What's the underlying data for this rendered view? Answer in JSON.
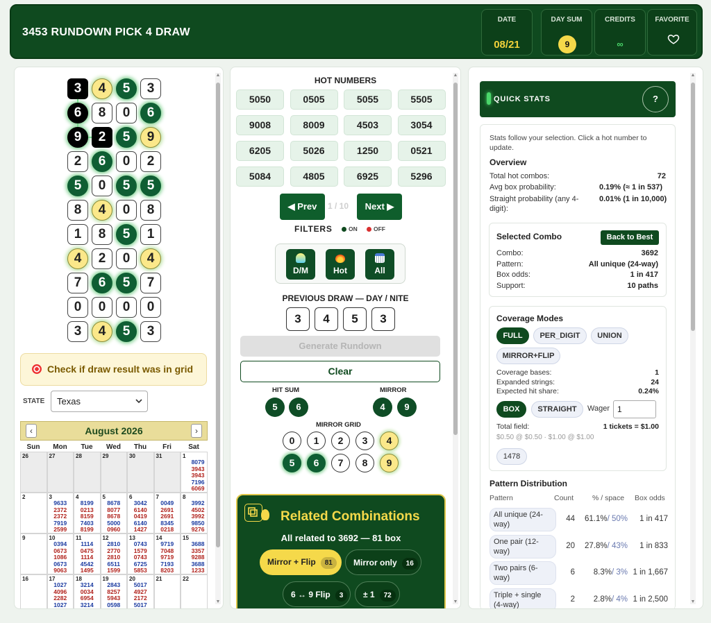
{
  "header": {
    "title": "3453 RUNDOWN PICK 4 DRAW",
    "date_label": "DATE",
    "date_value": "08/21",
    "daysum_label": "DAY SUM",
    "daysum_value": "9",
    "credits_label": "CREDITS",
    "credits_value": "∞",
    "favorite_label": "FAVORITE"
  },
  "grid": {
    "rows": [
      [
        {
          "v": "3",
          "s": "k"
        },
        {
          "v": "4",
          "s": "y"
        },
        {
          "v": "5",
          "s": "g"
        },
        {
          "v": "3",
          "s": "n"
        }
      ],
      [
        {
          "v": "6",
          "s": "kc"
        },
        {
          "v": "8",
          "s": "n"
        },
        {
          "v": "0",
          "s": "n"
        },
        {
          "v": "6",
          "s": "g"
        }
      ],
      [
        {
          "v": "9",
          "s": "kc"
        },
        {
          "v": "2",
          "s": "k"
        },
        {
          "v": "5",
          "s": "g"
        },
        {
          "v": "9",
          "s": "y"
        }
      ],
      [
        {
          "v": "2",
          "s": "n"
        },
        {
          "v": "6",
          "s": "g"
        },
        {
          "v": "0",
          "s": "n"
        },
        {
          "v": "2",
          "s": "n"
        }
      ],
      [
        {
          "v": "5",
          "s": "g"
        },
        {
          "v": "0",
          "s": "n"
        },
        {
          "v": "5",
          "s": "g"
        },
        {
          "v": "5",
          "s": "g"
        }
      ],
      [
        {
          "v": "8",
          "s": "n"
        },
        {
          "v": "4",
          "s": "y"
        },
        {
          "v": "0",
          "s": "n"
        },
        {
          "v": "8",
          "s": "n"
        }
      ],
      [
        {
          "v": "1",
          "s": "n"
        },
        {
          "v": "8",
          "s": "n"
        },
        {
          "v": "5",
          "s": "g"
        },
        {
          "v": "1",
          "s": "n"
        }
      ],
      [
        {
          "v": "4",
          "s": "y"
        },
        {
          "v": "2",
          "s": "n"
        },
        {
          "v": "0",
          "s": "n"
        },
        {
          "v": "4",
          "s": "y"
        }
      ],
      [
        {
          "v": "7",
          "s": "n"
        },
        {
          "v": "6",
          "s": "g"
        },
        {
          "v": "5",
          "s": "g"
        },
        {
          "v": "7",
          "s": "n"
        }
      ],
      [
        {
          "v": "0",
          "s": "n"
        },
        {
          "v": "0",
          "s": "n"
        },
        {
          "v": "0",
          "s": "n"
        },
        {
          "v": "0",
          "s": "n"
        }
      ],
      [
        {
          "v": "3",
          "s": "n"
        },
        {
          "v": "4",
          "s": "y"
        },
        {
          "v": "5",
          "s": "g"
        },
        {
          "v": "3",
          "s": "n"
        }
      ]
    ]
  },
  "check_label": "Check if draw result was in grid",
  "state": {
    "label": "STATE",
    "value": "Texas"
  },
  "calendar": {
    "month": "August 2026",
    "dow": [
      "Sun",
      "Mon",
      "Tue",
      "Wed",
      "Thu",
      "Fri",
      "Sat"
    ],
    "weeks": [
      [
        {
          "d": "26",
          "g": true,
          "n": []
        },
        {
          "d": "27",
          "g": true,
          "n": []
        },
        {
          "d": "28",
          "g": true,
          "n": []
        },
        {
          "d": "29",
          "g": true,
          "n": []
        },
        {
          "d": "30",
          "g": true,
          "n": []
        },
        {
          "d": "31",
          "g": true,
          "n": []
        },
        {
          "d": "1",
          "g": false,
          "n": [
            "8079",
            "3943",
            "3943",
            "7196",
            "6069"
          ]
        }
      ],
      [
        {
          "d": "2",
          "g": false,
          "n": []
        },
        {
          "d": "3",
          "g": false,
          "n": [
            "9633",
            "2372",
            "2372",
            "7919",
            "2599"
          ]
        },
        {
          "d": "4",
          "g": false,
          "n": [
            "8199",
            "0213",
            "8159",
            "7403",
            "8199"
          ]
        },
        {
          "d": "5",
          "g": false,
          "n": [
            "8678",
            "8077",
            "8678",
            "5000",
            "0960"
          ]
        },
        {
          "d": "6",
          "g": false,
          "n": [
            "3042",
            "6140",
            "0419",
            "6140",
            "1427"
          ]
        },
        {
          "d": "7",
          "g": false,
          "n": [
            "0049",
            "2691",
            "2691",
            "8345",
            "0218"
          ]
        },
        {
          "d": "8",
          "g": false,
          "n": [
            "3992",
            "4502",
            "3992",
            "9850",
            "9276"
          ]
        }
      ],
      [
        {
          "d": "9",
          "g": false,
          "n": []
        },
        {
          "d": "10",
          "g": false,
          "n": [
            "0394",
            "0673",
            "1086",
            "0673",
            "9063"
          ]
        },
        {
          "d": "11",
          "g": false,
          "n": [
            "1114",
            "0475",
            "1114",
            "4542",
            "1495"
          ]
        },
        {
          "d": "12",
          "g": false,
          "n": [
            "2810",
            "2770",
            "2810",
            "6511",
            "1599"
          ]
        },
        {
          "d": "13",
          "g": false,
          "n": [
            "0743",
            "1579",
            "0743",
            "6725",
            "5853"
          ]
        },
        {
          "d": "14",
          "g": false,
          "n": [
            "9719",
            "7048",
            "9719",
            "7193",
            "8203"
          ]
        },
        {
          "d": "15",
          "g": false,
          "n": [
            "3688",
            "3357",
            "9288",
            "3688",
            "1233"
          ]
        }
      ],
      [
        {
          "d": "16",
          "g": false,
          "n": []
        },
        {
          "d": "17",
          "g": false,
          "n": [
            "1027",
            "4096",
            "2282",
            "1027"
          ]
        },
        {
          "d": "18",
          "g": false,
          "n": [
            "3214",
            "0034",
            "6954",
            "3214"
          ]
        },
        {
          "d": "19",
          "g": false,
          "n": [
            "2843",
            "8257",
            "5943",
            "0598"
          ]
        },
        {
          "d": "20",
          "g": false,
          "n": [
            "5017",
            "4927",
            "2172",
            "5017"
          ]
        },
        {
          "d": "21",
          "g": false,
          "n": []
        },
        {
          "d": "22",
          "g": false,
          "n": []
        }
      ]
    ]
  },
  "hot": {
    "title": "HOT NUMBERS",
    "numbers": [
      "5050",
      "0505",
      "5055",
      "5505",
      "9008",
      "8009",
      "4503",
      "3054",
      "6205",
      "5026",
      "1250",
      "0521",
      "5084",
      "4805",
      "6925",
      "5296"
    ],
    "prev": "◀ Prev",
    "next": "Next ▶",
    "page": "1 / 10"
  },
  "filters": {
    "label": "FILTERS",
    "on": "ON",
    "off": "OFF",
    "buttons": [
      "D/M",
      "Hot",
      "All"
    ]
  },
  "prev_draw": {
    "label": "PREVIOUS DRAW — DAY / NITE",
    "digits": [
      "3",
      "4",
      "5",
      "3"
    ]
  },
  "generate_label": "Generate Rundown",
  "clear_label": "Clear",
  "hit_sum": {
    "label": "HIT SUM",
    "values": [
      "5",
      "6"
    ]
  },
  "mirror": {
    "label": "MIRROR",
    "values": [
      "4",
      "9"
    ]
  },
  "mirror_grid": {
    "label": "MIRROR GRID",
    "cells": [
      {
        "v": "0",
        "s": "n"
      },
      {
        "v": "1",
        "s": "n"
      },
      {
        "v": "2",
        "s": "n"
      },
      {
        "v": "3",
        "s": "n"
      },
      {
        "v": "4",
        "s": "y"
      },
      {
        "v": "5",
        "s": "g"
      },
      {
        "v": "6",
        "s": "g"
      },
      {
        "v": "7",
        "s": "n"
      },
      {
        "v": "8",
        "s": "n"
      },
      {
        "v": "9",
        "s": "y"
      }
    ]
  },
  "related": {
    "title": "Related Combinations",
    "subtitle": "All related to 3692 — 81 box",
    "pills": [
      {
        "label": "Mirror + Flip",
        "count": "81"
      },
      {
        "label": "Mirror only",
        "count": "16"
      },
      {
        "label": "6 ↔ 9 Flip",
        "count": "3"
      },
      {
        "label": "± 1",
        "count": "72"
      }
    ]
  },
  "stats": {
    "title": "QUICK STATS",
    "help": "?",
    "intro": "Stats follow your selection. Click a hot number to update.",
    "overview_title": "Overview",
    "overview": [
      {
        "k": "Total hot combos:",
        "v": "72"
      },
      {
        "k": "Avg box probability:",
        "v": "0.19% (≈ 1 in 537)"
      },
      {
        "k": "Straight probability (any 4-digit):",
        "v": "0.01% (1 in 10,000)"
      }
    ],
    "selected": {
      "title": "Selected Combo",
      "back_label": "Back to Best",
      "rows": [
        {
          "k": "Combo:",
          "v": "3692"
        },
        {
          "k": "Pattern:",
          "v": "All unique (24-way)"
        },
        {
          "k": "Box odds:",
          "v": "1 in 417"
        },
        {
          "k": "Support:",
          "v": "10 paths"
        }
      ]
    },
    "coverage": {
      "title": "Coverage Modes",
      "modes": [
        "FULL",
        "PER_DIGIT",
        "UNION",
        "MIRROR+FLIP"
      ],
      "rows": [
        {
          "k": "Coverage bases:",
          "v": "1"
        },
        {
          "k": "Expanded strings:",
          "v": "24"
        },
        {
          "k": "Expected hit share:",
          "v": "0.24%"
        }
      ],
      "box_label": "BOX",
      "straight_label": "STRAIGHT",
      "wager_label": "Wager",
      "wager_value": "1",
      "total_label": "Total field:",
      "total_value": "1 tickets = $1.00",
      "price_note": "$0.50 @ $0.50 · $1.00 @ $1.00",
      "tag": "1478"
    },
    "pattern": {
      "title": "Pattern Distribution",
      "headers": [
        "Pattern",
        "Count",
        "% / space",
        "Box odds"
      ],
      "rows": [
        {
          "p": "All unique (24-way)",
          "c": "44",
          "pct": "61.1%",
          "sp": "/ 50%",
          "o": "1 in 417"
        },
        {
          "p": "One pair (12-way)",
          "c": "20",
          "pct": "27.8%",
          "sp": "/ 43%",
          "o": "1 in 833"
        },
        {
          "p": "Two pairs (6-way)",
          "c": "6",
          "pct": "8.3%",
          "sp": "/ 3%",
          "o": "1 in 1,667"
        },
        {
          "p": "Triple + single (4-way)",
          "c": "2",
          "pct": "2.8%",
          "sp": "/ 4%",
          "o": "1 in 2,500"
        }
      ]
    }
  }
}
